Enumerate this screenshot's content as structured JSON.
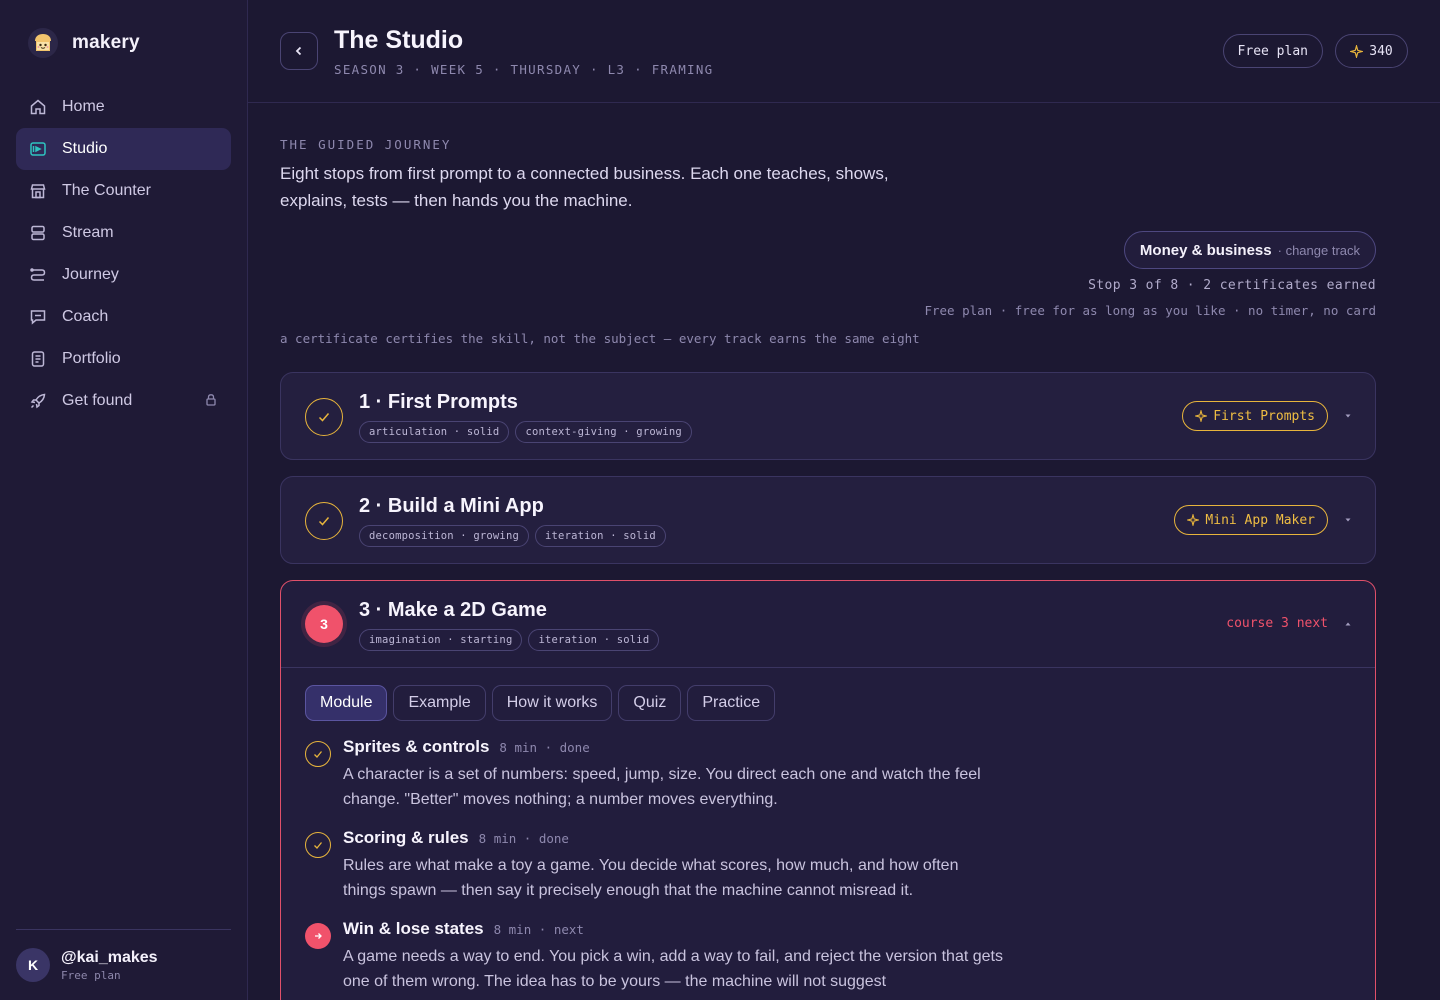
{
  "brand": {
    "name": "makery"
  },
  "sidebar": {
    "items": [
      {
        "label": "Home",
        "icon": "home-icon"
      },
      {
        "label": "Studio",
        "icon": "studio-icon",
        "active": true
      },
      {
        "label": "The Counter",
        "icon": "store-icon"
      },
      {
        "label": "Stream",
        "icon": "stream-icon"
      },
      {
        "label": "Journey",
        "icon": "route-icon"
      },
      {
        "label": "Coach",
        "icon": "chat-icon"
      },
      {
        "label": "Portfolio",
        "icon": "portfolio-icon"
      },
      {
        "label": "Get found",
        "icon": "rocket-icon",
        "locked": true
      }
    ],
    "user": {
      "initial": "K",
      "handle": "@kai_makes",
      "plan": "Free plan"
    }
  },
  "header": {
    "title": "The Studio",
    "breadcrumb": "SEASON 3 · WEEK 5 · THURSDAY · L3 · FRAMING",
    "plan": "Free plan",
    "points": "340"
  },
  "journey": {
    "eyebrow": "THE GUIDED JOURNEY",
    "intro": "Eight stops from first prompt to a connected business. Each one teaches, shows, explains, tests — then hands you the machine.",
    "track": {
      "name": "Money & business",
      "change": "· change track"
    },
    "stop_line": "Stop 3 of 8 · 2 certificates earned",
    "free_line": "Free plan · free for as long as you like · no timer, no card",
    "cert_note": "a certificate certifies the skill, not the subject — every track earns the same eight"
  },
  "courses": [
    {
      "title": "1 · First Prompts",
      "tags": [
        "articulation · solid",
        "context-giving · growing"
      ],
      "certificate": "First Prompts",
      "status": "done"
    },
    {
      "title": "2 · Build a Mini App",
      "tags": [
        "decomposition · growing",
        "iteration · solid"
      ],
      "certificate": "Mini App Maker",
      "status": "done"
    },
    {
      "number": "3",
      "title": "3 · Make a 2D Game",
      "tags": [
        "imagination · starting",
        "iteration · solid"
      ],
      "next_label": "course 3 next",
      "status": "current",
      "tabs": [
        "Module",
        "Example",
        "How it works",
        "Quiz",
        "Practice"
      ],
      "lessons": [
        {
          "title": "Sprites & controls",
          "meta": "8 min · done",
          "desc": "A character is a set of numbers: speed, jump, size. You direct each one and watch the feel change. \"Better\" moves nothing; a number moves everything.",
          "status": "done"
        },
        {
          "title": "Scoring & rules",
          "meta": "8 min · done",
          "desc": "Rules are what make a toy a game. You decide what scores, how much, and how often things spawn — then say it precisely enough that the machine cannot misread it.",
          "status": "done"
        },
        {
          "title": "Win & lose states",
          "meta": "8 min · next",
          "desc": "A game needs a way to end. You pick a win, add a way to fail, and reject the version that gets one of them wrong. The idea has to be yours — the machine will not suggest",
          "status": "next"
        }
      ]
    }
  ],
  "colors": {
    "accent_gold": "#e7b43c",
    "accent_red": "#f0526b",
    "background": "#1c1832",
    "sidebar": "#1f1a36"
  }
}
